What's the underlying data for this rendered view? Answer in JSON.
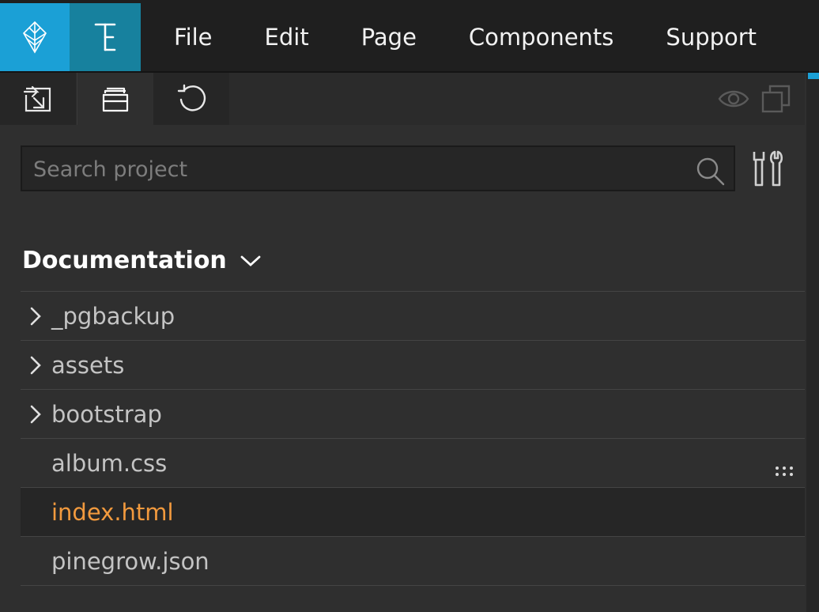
{
  "app": {
    "mode_letter": "E",
    "menu": [
      "File",
      "Edit",
      "Page",
      "Components",
      "Support"
    ]
  },
  "toolbar": {
    "buttons": [
      "import-icon",
      "project-files-icon",
      "refresh-icon"
    ],
    "right_icons": [
      "eye-icon",
      "windows-icon"
    ]
  },
  "search": {
    "placeholder": "Search project",
    "value": ""
  },
  "project": {
    "name": "Documentation",
    "items": [
      {
        "label": "_pgbackup",
        "type": "folder"
      },
      {
        "label": "assets",
        "type": "folder"
      },
      {
        "label": "bootstrap",
        "type": "folder"
      },
      {
        "label": "album.css",
        "type": "file"
      },
      {
        "label": "index.html",
        "type": "file",
        "selected": true
      },
      {
        "label": "pinegrow.json",
        "type": "file"
      }
    ]
  },
  "colors": {
    "brand_blue": "#1ba0d6",
    "mode_teal": "#17819e",
    "selected_text": "#f29a3e"
  }
}
